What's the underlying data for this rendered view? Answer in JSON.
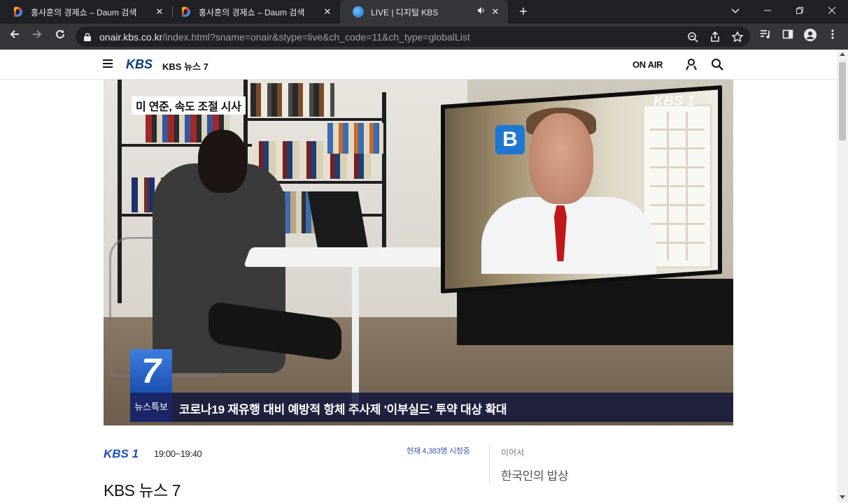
{
  "browser": {
    "tabs": [
      {
        "title": "홍사훈의 경제쇼 – Daum 검색",
        "favicon": "daum-icon",
        "active": false
      },
      {
        "title": "홍사훈의 경제쇼 – Daum 검색",
        "favicon": "daum-icon",
        "active": false
      },
      {
        "title": "LIVE | 디지털 KBS",
        "favicon": "kbs-globe-icon",
        "active": true,
        "audio": true
      }
    ],
    "new_tab_label": "+",
    "url_domain": "onair.kbs.co.kr",
    "url_path": "/index.html?sname=onair&stype=live&ch_code=11&ch_type=globalList"
  },
  "header": {
    "brand": "KBS",
    "program": "KBS 뉴스 7",
    "onair": "ON AIR"
  },
  "video": {
    "headline_tag": "미 연준, 속도 조절 시사",
    "watermark": "KBS 1",
    "channel_badge": "7",
    "caption_tag": "뉴스특보",
    "caption": "코로나19 재유행 대비 예방적 항체 주사제 '이부실드' 투약 대상 확대",
    "guest_logo": "B"
  },
  "info": {
    "channel_logo": "KBS 1",
    "time_range": "19:00~19:40",
    "program_name": "KBS 뉴스 7",
    "viewers": "현재 4,383명 시청중",
    "next_label": "이어서",
    "next_program": "한국인의 밥상"
  },
  "colors": {
    "chrome_dark": "#202124",
    "chrome_toolbar": "#35363a",
    "kbs_blue": "#003a8c",
    "viewer_blue": "#3b5bb5"
  }
}
